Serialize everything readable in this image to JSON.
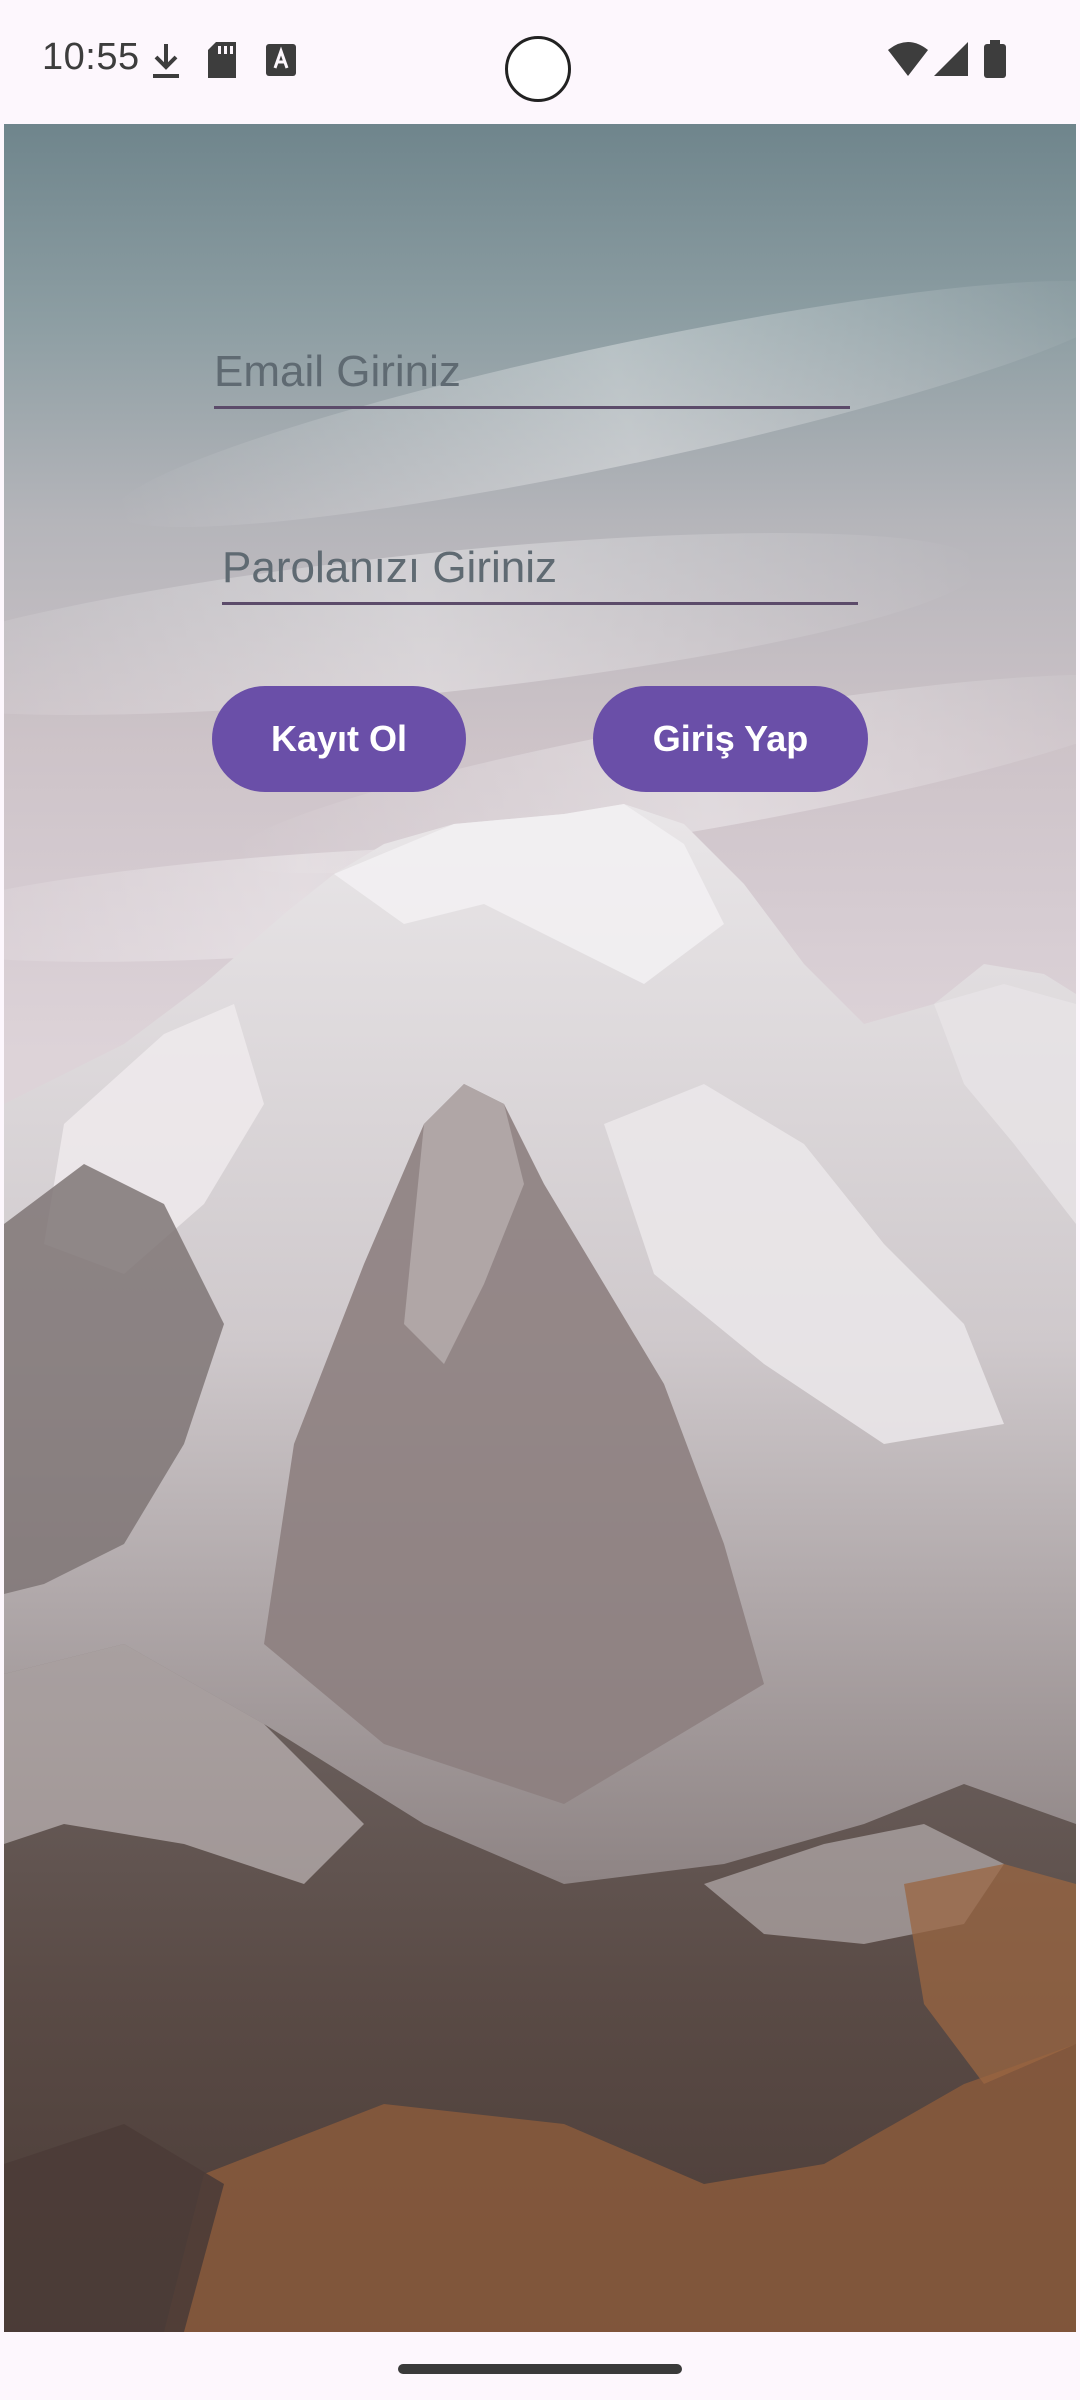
{
  "status_bar": {
    "time": "10:55",
    "left_icons": [
      "download-icon",
      "sd-card-icon",
      "text-a-icon"
    ],
    "right_icons": [
      "wifi-icon",
      "cell-signal-icon",
      "battery-icon"
    ]
  },
  "login_form": {
    "email_placeholder": "Email Giriniz",
    "email_value": "",
    "password_placeholder": "Parolanızı Giriniz",
    "password_value": ""
  },
  "buttons": {
    "register_label": "Kayıt Ol",
    "login_label": "Giriş Yap"
  },
  "colors": {
    "accent": "#6a4fa8",
    "button_text": "#ffffff",
    "field_underline": "#5c4b6a"
  }
}
